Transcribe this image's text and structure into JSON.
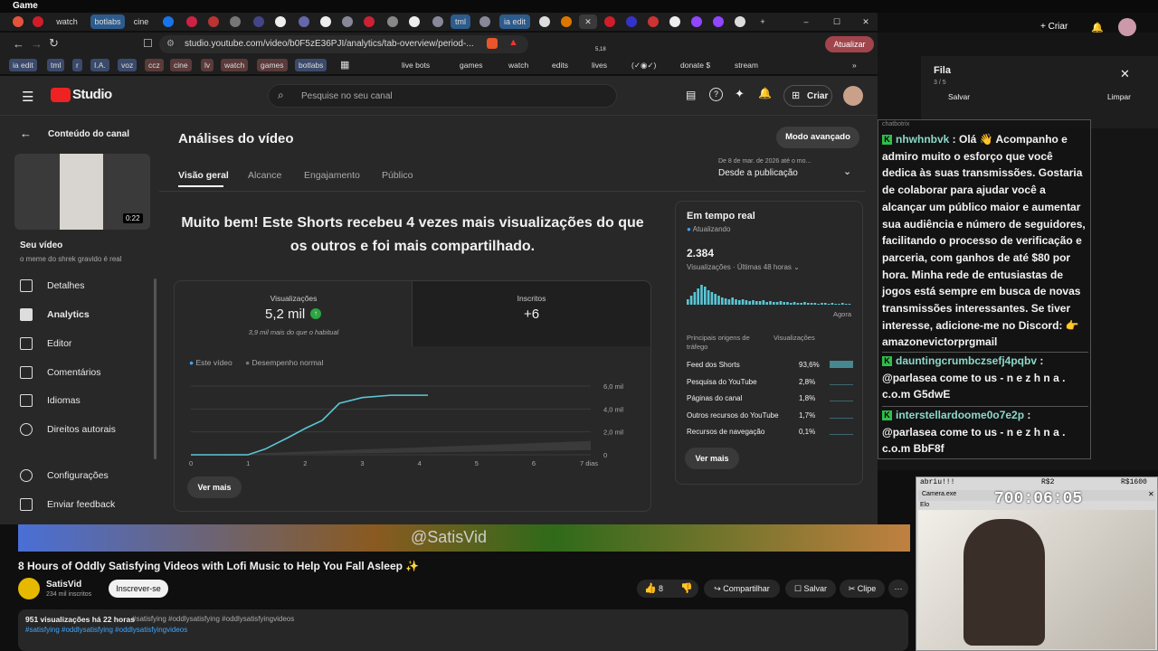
{
  "window_title": "Game",
  "tabs": [
    "watch",
    "botlabs",
    "cine",
    "tml",
    "ia edit"
  ],
  "address_bar": {
    "url": "studio.youtube.com/video/b0F5zE36PJI/analytics/tab-overview/period-...",
    "update_label": "Atualizar",
    "ext_count": "5,18"
  },
  "bookmarks": [
    "ia edit",
    "tml",
    "r",
    "I.A.",
    "voz",
    "ccz",
    "cine",
    "lv",
    "watch",
    "games",
    "botlabs",
    "live bots",
    "games",
    "watch",
    "edits",
    "lives",
    "(✓◉✓)",
    "donate $",
    "stream"
  ],
  "studio": {
    "logo": "Studio",
    "search_placeholder": "Pesquise no seu canal",
    "create_label": "Criar",
    "back_label": "Conteúdo do canal",
    "video_duration": "0:22",
    "your_video_label": "Seu vídeo",
    "video_title": "o meme do shrek gravido é real",
    "nav": [
      "Detalhes",
      "Analytics",
      "Editor",
      "Comentários",
      "Idiomas",
      "Direitos autorais"
    ],
    "config": "Configurações",
    "feedback": "Enviar feedback",
    "page_title": "Análises do vídeo",
    "advanced_mode": "Modo avançado",
    "main_tabs": [
      "Visão geral",
      "Alcance",
      "Engajamento",
      "Público"
    ],
    "date_range_small": "De 8 de mar. de 2026 até o mo...",
    "date_range": "Desde a publicação",
    "headline": "Muito bem! Este Shorts recebeu 4 vezes mais visualizações do que os outros e foi mais compartilhado.",
    "views_label": "Visualizações",
    "views_value": "5,2 mil",
    "views_sub": "3,9 mil mais do que o habitual",
    "subs_label": "Inscritos",
    "subs_value": "+6",
    "legend_this": "Este vídeo",
    "legend_normal": "Desempenho normal",
    "see_more": "Ver mais",
    "realtime_title": "Em tempo real",
    "realtime_updated": "Atualizando",
    "realtime_value": "2.384",
    "realtime_sub": "Visualizações · Últimas 48 horas",
    "now_label": "Agora",
    "traffic_header": "Principais origens de tráfego",
    "traffic_views": "Visualizações",
    "traffic": [
      {
        "name": "Feed dos Shorts",
        "pct": "93,6%"
      },
      {
        "name": "Pesquisa do YouTube",
        "pct": "2,8%"
      },
      {
        "name": "Páginas do canal",
        "pct": "1,8%"
      },
      {
        "name": "Outros recursos do YouTube",
        "pct": "1,7%"
      },
      {
        "name": "Recursos de navegação",
        "pct": "0,1%"
      }
    ],
    "realtime_more": "Ver mais"
  },
  "chart_data": {
    "type": "line",
    "x": [
      0,
      1,
      1.3,
      1.7,
      2,
      2.3,
      2.6,
      3,
      3.5,
      4,
      4.15
    ],
    "y": [
      0,
      0,
      0.5,
      1.5,
      2.3,
      3.0,
      4.5,
      5.0,
      5.2,
      5.2,
      5.2
    ],
    "xticks": [
      "0",
      "1",
      "2",
      "3",
      "4",
      "5",
      "6",
      "7 dias"
    ],
    "yticks": [
      "0",
      "2,0 mil",
      "4,0 mil",
      "6,0 mil"
    ],
    "xlim": [
      0,
      7
    ],
    "ylim": [
      0,
      6
    ]
  },
  "youtube": {
    "watermark": "@SatisVid",
    "video_title": "8 Hours of Oddly Satisfying Videos with Lofi Music to Help You Fall Asleep ✨",
    "channel": "SatisVid",
    "subs": "234 mil inscritos",
    "subscribe": "Inscrever-se",
    "likes": "8",
    "share": "Compartilhar",
    "save": "Salvar",
    "clip": "Clipe",
    "views_line": "951 visualizações  há 22 horas",
    "tags": "#satisfying #oddlysatisfying #oddlysatisfyingvideos"
  },
  "queue": {
    "title": "Fila",
    "count": "3 / 5",
    "save": "Salvar",
    "clear": "Limpar"
  },
  "yt_right": {
    "create": "Criar"
  },
  "chat": {
    "brand": "chatbotrix",
    "messages": [
      {
        "user": "nhwhnbvk",
        "text": " : Olá 👋 Acompanho e admiro muito o esforço que você dedica às suas transmissões. Gostaria de colaborar para ajudar você a alcançar um público maior e aumentar sua audiência e número de seguidores, facilitando o processo de verificação e parceria, com ganhos de até $80 por hora. Minha rede de entusiastas de jogos está sempre em busca de novas transmissões interessantes. Se tiver interesse, adicione-me no Discord: 👉 amazonevictorprgmail"
      },
      {
        "user": "dauntingcrumbczsefj4pqbv",
        "text": " : @parlasea come to us - n e z h n a . c.o.m G5dwE"
      },
      {
        "user": "interstellardoome0o7e2p",
        "text": " : @parlasea come to us - n e z h n a . c.o.m BbF8f"
      }
    ]
  },
  "camera": {
    "left_label": "abriu!!!",
    "mid_label": "R$2",
    "right_label": "R$1600",
    "window": "Camera.exe",
    "timer": "700:06:05",
    "sub": "Elo"
  }
}
